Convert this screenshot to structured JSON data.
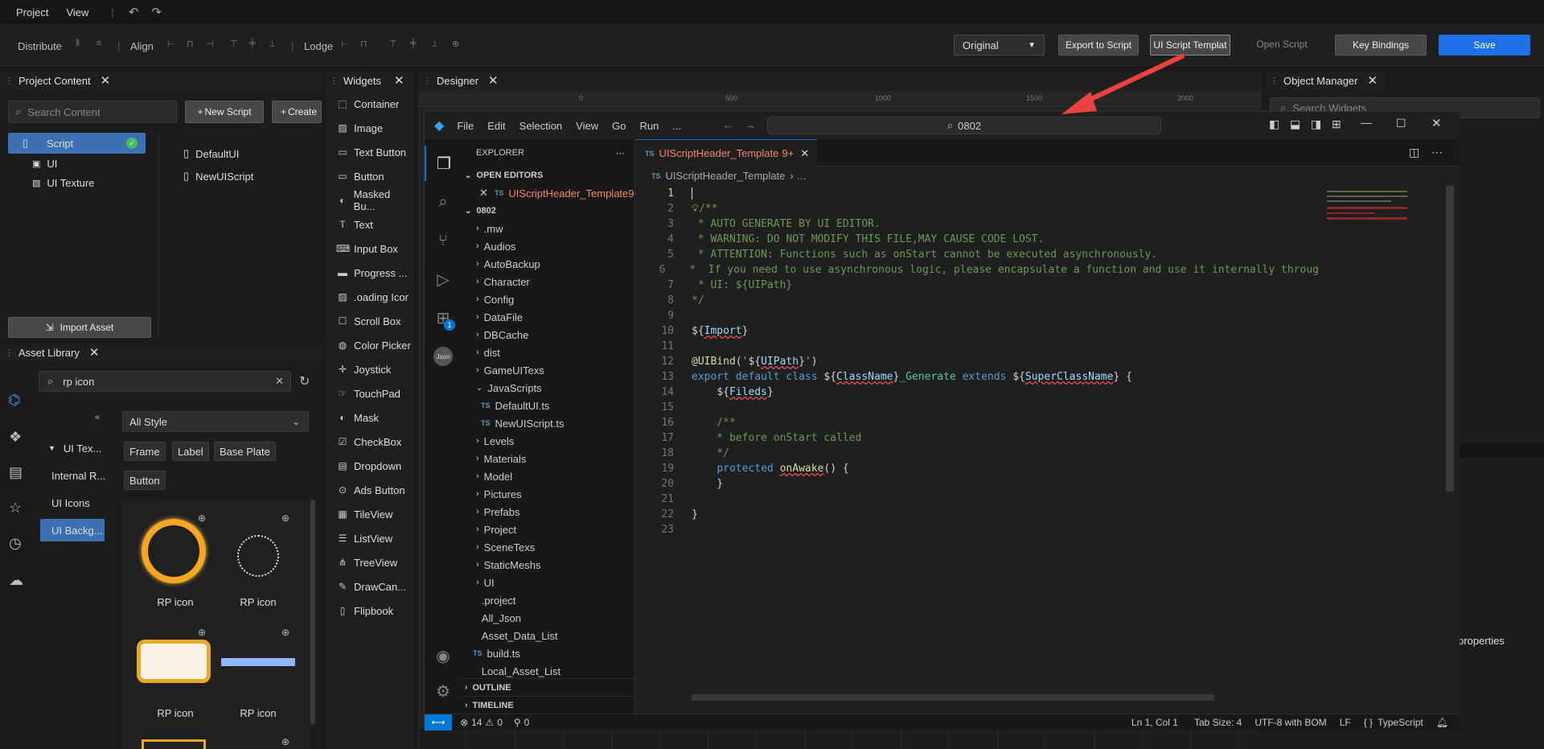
{
  "menubar": {
    "items": [
      "Project",
      "View"
    ]
  },
  "toolbar": {
    "distribute": "Distribute",
    "align": "Align",
    "lodge": "Lodge",
    "view_mode": "Original",
    "export_script": "Export to Script",
    "ui_script_template": "UI Script Templat",
    "open_script": "Open Script",
    "key_bindings": "Key Bindings",
    "save": "Save"
  },
  "project_content": {
    "title": "Project Content",
    "search_placeholder": "Search Content",
    "new_script": "New Script",
    "create": "Create",
    "tree": [
      "Script",
      "UI",
      "UI Texture"
    ],
    "files": [
      "DefaultUI",
      "NewUIScript"
    ],
    "import_asset": "Import Asset"
  },
  "asset_library": {
    "title": "Asset Library",
    "search_value": "rp icon",
    "style_select": "All Style",
    "chips": [
      "Frame",
      "Label",
      "Base Plate",
      "Button"
    ],
    "categories": [
      "UI Tex...",
      "Internal R...",
      "UI Icons",
      "UI Backg..."
    ],
    "cards": [
      "RP icon",
      "RP icon",
      "RP icon",
      "RP icon"
    ]
  },
  "widgets": {
    "title": "Widgets",
    "items": [
      "Container",
      "Image",
      "Text Button",
      "Button",
      "Masked Bu...",
      "Text",
      "Input Box",
      "Progress ...",
      ".oading Icor",
      "Scroll Box",
      "Color Picker",
      "Joystick",
      "TouchPad",
      "Mask",
      "CheckBox",
      "Dropdown",
      "Ads Button",
      "TileView",
      "ListView",
      "TreeView",
      "DrawCan...",
      "Flipbook"
    ]
  },
  "designer": {
    "title": "Designer",
    "ruler": [
      "0",
      "500",
      "1000",
      "1500",
      "2000"
    ]
  },
  "object_manager": {
    "title": "Object Manager",
    "search_placeholder": "Search Widgets",
    "properties": "properties"
  },
  "vscode": {
    "menu": [
      "File",
      "Edit",
      "Selection",
      "View",
      "Go",
      "Run",
      "..."
    ],
    "search": "0802",
    "explorer_title": "EXPLORER",
    "open_editors": "OPEN EDITORS",
    "open_file": "UIScriptHeader_Template",
    "open_file_badge": "9+",
    "workspace": "0802",
    "tree": [
      {
        "label": ".mw",
        "type": "folder"
      },
      {
        "label": "Audios",
        "type": "folder"
      },
      {
        "label": "AutoBackup",
        "type": "folder"
      },
      {
        "label": "Character",
        "type": "folder"
      },
      {
        "label": "Config",
        "type": "folder"
      },
      {
        "label": "DataFile",
        "type": "folder"
      },
      {
        "label": "DBCache",
        "type": "folder"
      },
      {
        "label": "dist",
        "type": "folder"
      },
      {
        "label": "GameUITexs",
        "type": "folder"
      },
      {
        "label": "JavaScripts",
        "type": "open"
      },
      {
        "label": "DefaultUI.ts",
        "type": "ts"
      },
      {
        "label": "NewUIScript.ts",
        "type": "ts"
      },
      {
        "label": "Levels",
        "type": "folder"
      },
      {
        "label": "Materials",
        "type": "folder"
      },
      {
        "label": "Model",
        "type": "folder"
      },
      {
        "label": "Pictures",
        "type": "folder"
      },
      {
        "label": "Prefabs",
        "type": "folder"
      },
      {
        "label": "Project",
        "type": "folder"
      },
      {
        "label": "SceneTexs",
        "type": "folder"
      },
      {
        "label": "StaticMeshs",
        "type": "folder"
      },
      {
        "label": "UI",
        "type": "folder"
      },
      {
        "label": ".project",
        "type": "file"
      },
      {
        "label": "All_Json",
        "type": "file"
      },
      {
        "label": "Asset_Data_List",
        "type": "file"
      },
      {
        "label": "build.ts",
        "type": "ts"
      },
      {
        "label": "Local_Asset_List",
        "type": "file"
      }
    ],
    "outline": "OUTLINE",
    "timeline": "TIMELINE",
    "tab_title": "UIScriptHeader_Template",
    "tab_badge": "9+",
    "breadcrumb": "UIScriptHeader_Template",
    "code": [
      "",
      "/**",
      " * AUTO GENERATE BY UI EDITOR.",
      " * WARNING: DO NOT MODIFY THIS FILE,MAY CAUSE CODE LOST.",
      " * ATTENTION: Functions such as onStart cannot be executed asynchronously.",
      " *  If you need to use asynchronous logic, please encapsulate a function and use it internally throug",
      " * UI: ${UIPath}",
      "*/",
      "",
      "${Import}",
      "",
      "@UIBind('${UIPath}')",
      "export default class ${ClassName}_Generate extends ${SuperClassName} {",
      "    ${Fileds}",
      "",
      "    /**",
      "    * before onStart called",
      "    */",
      "    protected onAwake() {",
      "    }",
      "",
      "}",
      ""
    ],
    "status": {
      "errors": "14",
      "warnings": "0",
      "ports": "0",
      "position": "Ln 1, Col 1",
      "tab_size": "Tab Size: 4",
      "encoding": "UTF-8 with BOM",
      "eol": "LF",
      "language": "TypeScript"
    }
  },
  "colors": {
    "accent": "#1f6fe8",
    "selection": "#3d6fb3",
    "annotation_arrow": "#e9423f"
  }
}
